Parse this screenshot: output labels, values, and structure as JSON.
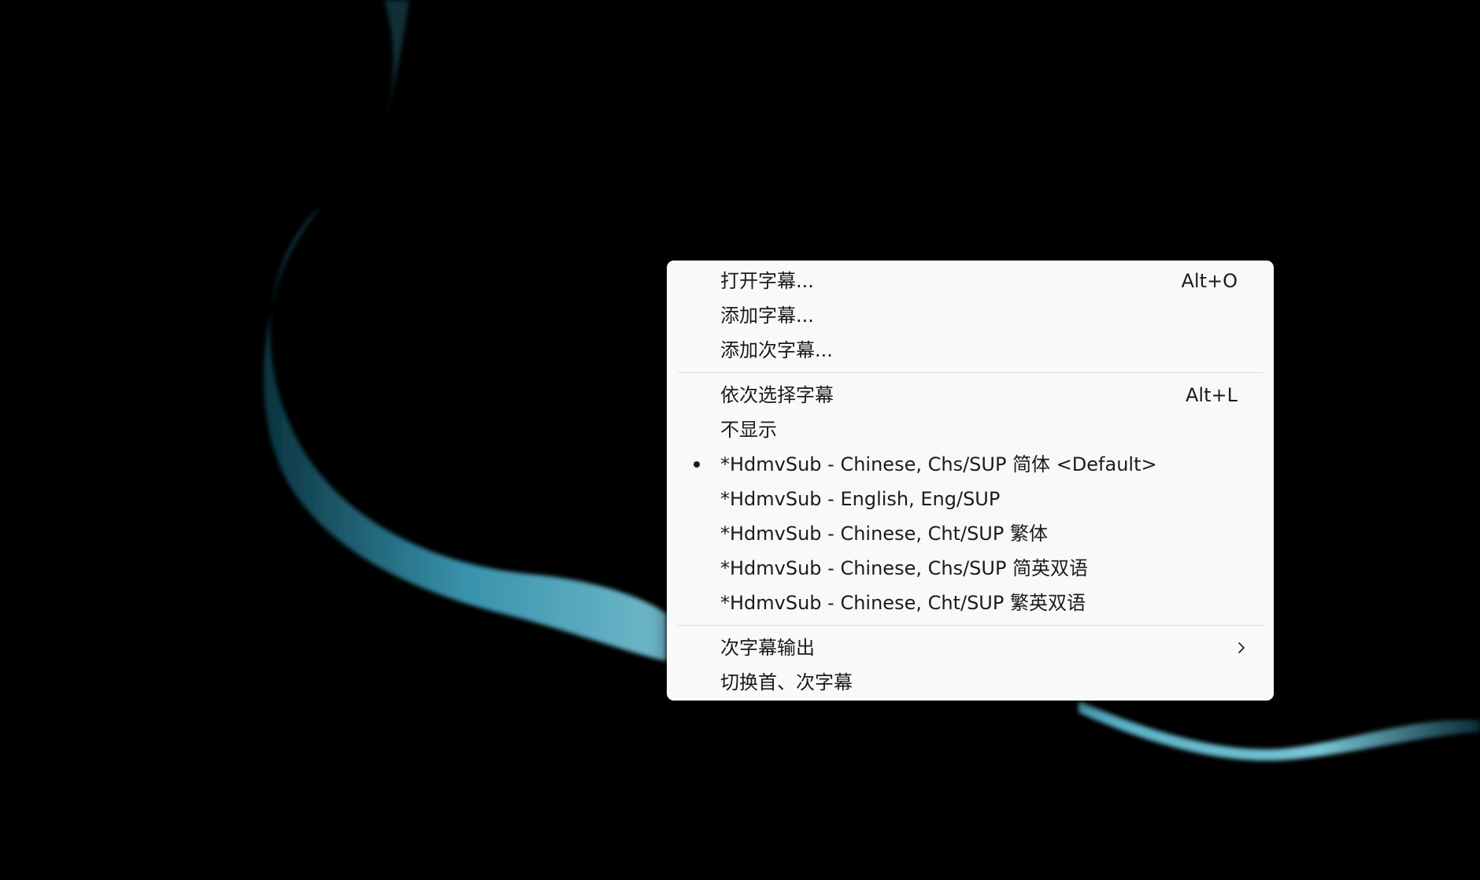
{
  "menu": {
    "group1": [
      {
        "label": "打开字幕...",
        "shortcut": "Alt+O"
      },
      {
        "label": "添加字幕...",
        "shortcut": ""
      },
      {
        "label": "添加次字幕...",
        "shortcut": ""
      }
    ],
    "group2": [
      {
        "label": "依次选择字幕",
        "shortcut": "Alt+L"
      },
      {
        "label": "不显示",
        "shortcut": ""
      },
      {
        "label": "*HdmvSub - Chinese, Chs/SUP  简体 <Default>",
        "selected": true
      },
      {
        "label": "*HdmvSub - English, Eng/SUP"
      },
      {
        "label": "*HdmvSub - Chinese, Cht/SUP  繁体"
      },
      {
        "label": "*HdmvSub - Chinese, Chs/SUP  简英双语"
      },
      {
        "label": "*HdmvSub - Chinese, Cht/SUP  繁英双语"
      }
    ],
    "group3": [
      {
        "label": "次字幕输出",
        "submenu_icon": "chevron-right-icon"
      },
      {
        "label": "切换首、次字幕"
      }
    ]
  },
  "colors": {
    "background": "#000000",
    "menu_bg": "#f9f9f9",
    "text": "#1b1b1b",
    "separator": "#dcdcdc",
    "ribbon": "#5fb8cf"
  }
}
